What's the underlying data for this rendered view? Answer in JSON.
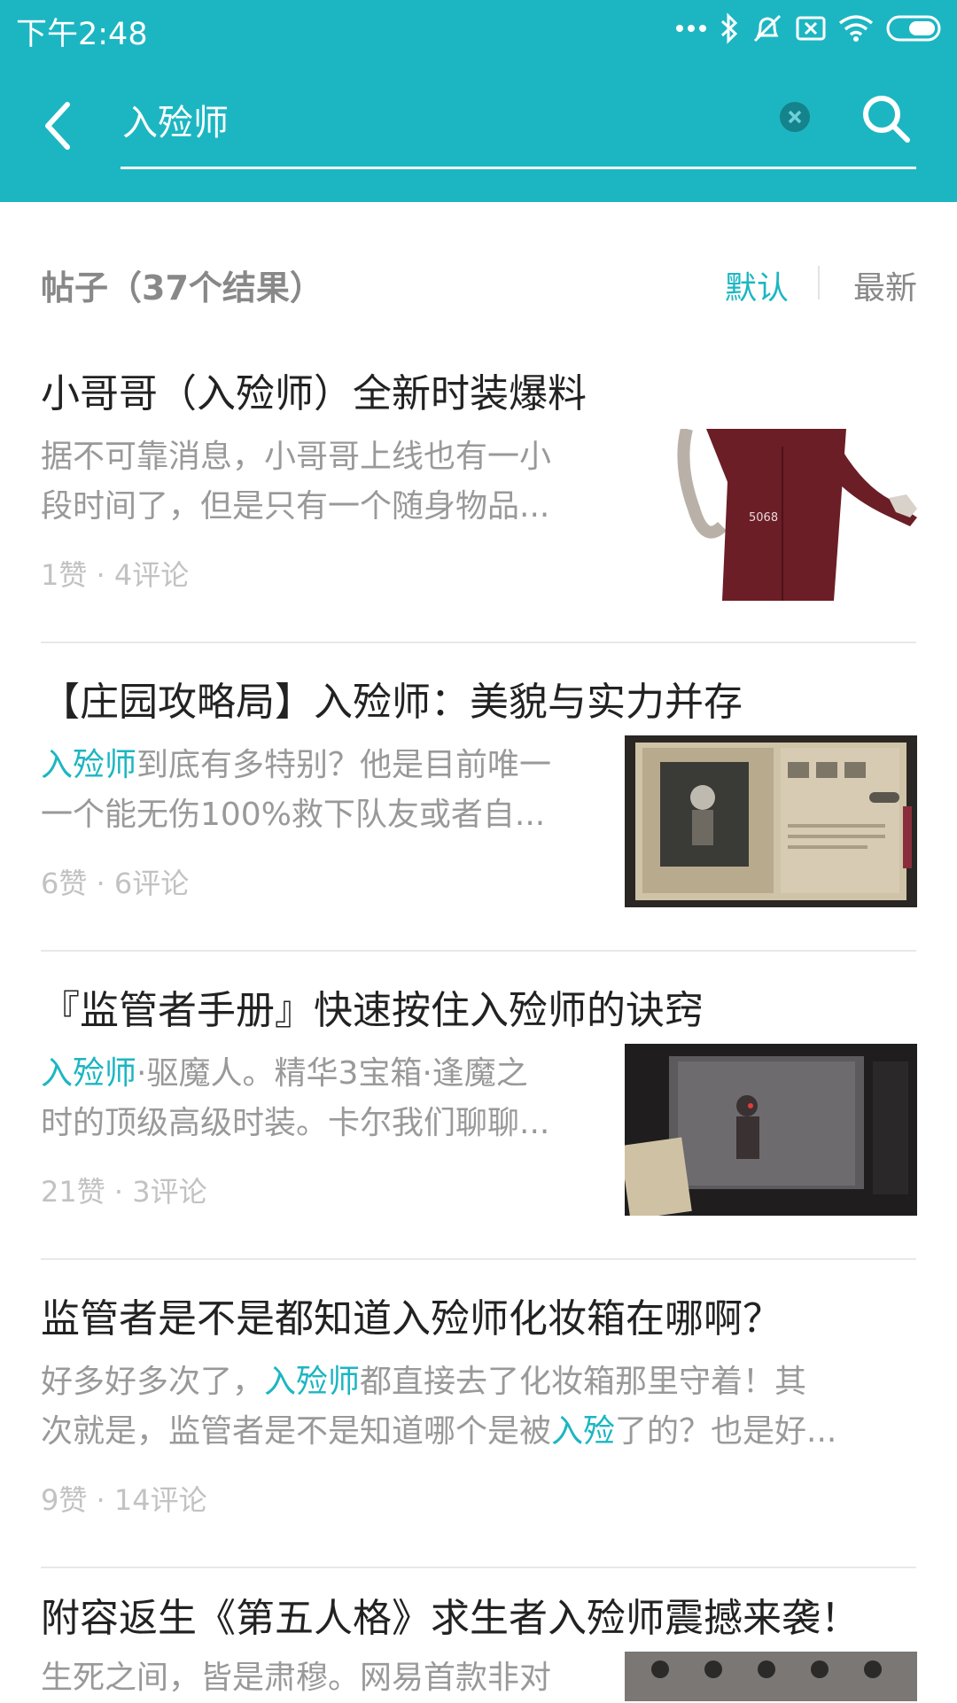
{
  "status_bar": {
    "time": "下午2:48"
  },
  "search": {
    "query": "入殓师"
  },
  "results_header": {
    "label": "帖子（37个结果）",
    "sort_default": "默认",
    "sort_latest": "最新"
  },
  "posts": [
    {
      "title": "小哥哥（入殓师）全新时装爆料",
      "excerpt_line1": "据不可靠消息，小哥哥上线也有一小",
      "excerpt_line2": "段时间了，但是只有一个随身物品...",
      "meta": "1赞 · 4评论",
      "thumb_caption": "5068"
    },
    {
      "title": "【庄园攻略局】入殓师：美貌与实力并存",
      "excerpt_hl": "入殓师",
      "excerpt_line1_rest": "到底有多特别？他是目前唯一",
      "excerpt_line2": "一个能无伤100%救下队友或者自...",
      "meta": "6赞 · 6评论"
    },
    {
      "title": "『监管者手册』快速按住入殓师的诀窍",
      "excerpt_hl": "入殓师",
      "excerpt_line1_rest": "·驱魔人。精华3宝箱·逢魔之",
      "excerpt_line2": "时的顶级高级时装。卡尔我们聊聊...",
      "meta": "21赞 · 3评论"
    },
    {
      "title": "监管者是不是都知道入殓师化妆箱在哪啊？",
      "excerpt_line1_a": "好多好多次了，",
      "excerpt_line1_hl": "入殓师",
      "excerpt_line1_b": "都直接去了化妆箱那里守着！其",
      "excerpt_line2_a": "次就是，监管者是不是知道哪个是被",
      "excerpt_line2_hl": "入殓",
      "excerpt_line2_b": "了的？也是好...",
      "meta": "9赞 · 14评论"
    },
    {
      "title": "附容返生《第五人格》求生者入殓师震撼来袭！",
      "excerpt_line1": "生死之间，皆是肃穆。网易首款非对"
    }
  ]
}
